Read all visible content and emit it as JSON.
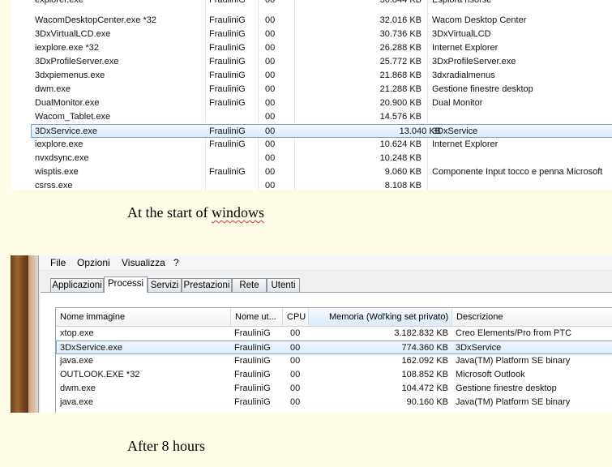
{
  "screenshot1": {
    "rows": [
      {
        "name": "explorer.exe",
        "user": "FrauliniG",
        "cpu": "00",
        "mem": "36.844 KB",
        "desc": "Esplora risorse"
      },
      {
        "name": "WacomDesktopCenter.exe *32",
        "user": "FrauliniG",
        "cpu": "00",
        "mem": "32.016 KB",
        "desc": "Wacom Desktop Center"
      },
      {
        "name": "3DxVirtualLCD.exe",
        "user": "FrauliniG",
        "cpu": "00",
        "mem": "30.736 KB",
        "desc": "3DxVirtualLCD"
      },
      {
        "name": "iexplore.exe *32",
        "user": "FrauliniG",
        "cpu": "00",
        "mem": "26.288 KB",
        "desc": "Internet Explorer"
      },
      {
        "name": "3DxProfileServer.exe",
        "user": "FrauliniG",
        "cpu": "00",
        "mem": "25.772 KB",
        "desc": "3DxProfileServer.exe"
      },
      {
        "name": "3dxpiemenus.exe",
        "user": "FrauliniG",
        "cpu": "00",
        "mem": "21.868 KB",
        "desc": "3dxradialmenus"
      },
      {
        "name": "dwm.exe",
        "user": "FrauliniG",
        "cpu": "00",
        "mem": "21.288 KB",
        "desc": "Gestione finestre desktop"
      },
      {
        "name": "DualMonitor.exe",
        "user": "FrauliniG",
        "cpu": "00",
        "mem": "20.900 KB",
        "desc": "Dual Monitor"
      },
      {
        "name": "Wacom_Tablet.exe",
        "user": "",
        "cpu": "00",
        "mem": "14.576 KB",
        "desc": ""
      },
      {
        "name": "3DxService.exe",
        "user": "FrauliniG",
        "cpu": "00",
        "mem": "13.040 KB",
        "desc": "3DxService"
      },
      {
        "name": "iexplore.exe",
        "user": "FrauliniG",
        "cpu": "00",
        "mem": "10.624 KB",
        "desc": "Internet Explorer"
      },
      {
        "name": "nvxdsync.exe",
        "user": "",
        "cpu": "00",
        "mem": "10.248 KB",
        "desc": ""
      },
      {
        "name": "wisptis.exe",
        "user": "FrauliniG",
        "cpu": "00",
        "mem": "9.060 KB",
        "desc": "Componente Input tocco e penna Microsoft"
      },
      {
        "name": "csrss.exe",
        "user": "",
        "cpu": "00",
        "mem": "8.108 KB",
        "desc": ""
      }
    ]
  },
  "caption1": {
    "prefix": "At the start of ",
    "word": "windows"
  },
  "caption2": "After 8 hours",
  "screenshot2": {
    "menu": [
      "File",
      "Opzioni",
      "Visualizza",
      "?"
    ],
    "tabs": [
      "Applicazioni",
      "Processi",
      "Servizi",
      "Prestazioni",
      "Rete",
      "Utenti"
    ],
    "columns": [
      "Nome immagine",
      "Nome ut...",
      "CPU",
      "Memoria (Working set privato)",
      "Descrizione"
    ],
    "rows": [
      {
        "name": "xtop.exe",
        "user": "FrauliniG",
        "cpu": "00",
        "mem": "3.182.832 KB",
        "desc": "Creo Elements/Pro from PTC"
      },
      {
        "name": "3DxService.exe",
        "user": "FrauliniG",
        "cpu": "00",
        "mem": "774.360 KB",
        "desc": "3DxService"
      },
      {
        "name": "java.exe",
        "user": "FrauliniG",
        "cpu": "00",
        "mem": "162.092 KB",
        "desc": "Java(TM) Platform SE binary"
      },
      {
        "name": "OUTLOOK.EXE *32",
        "user": "FrauliniG",
        "cpu": "00",
        "mem": "108.852 KB",
        "desc": "Microsoft Outlook"
      },
      {
        "name": "dwm.exe",
        "user": "FrauliniG",
        "cpu": "00",
        "mem": "104.472 KB",
        "desc": "Gestione finestre desktop"
      },
      {
        "name": "java.exe",
        "user": "FrauliniG",
        "cpu": "00",
        "mem": "90.160 KB",
        "desc": "Java(TM) Platform SE binary"
      }
    ]
  }
}
